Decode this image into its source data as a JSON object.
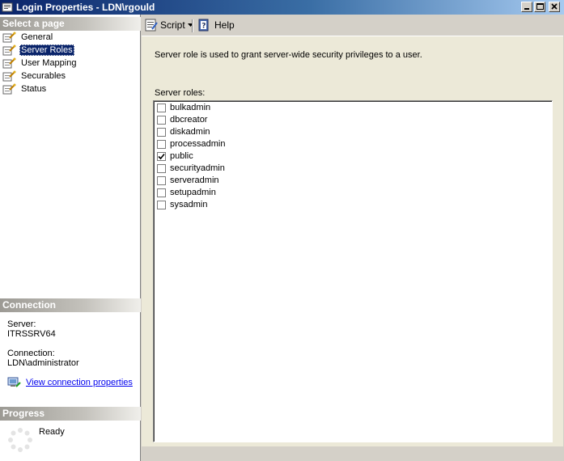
{
  "window": {
    "title": "Login Properties - LDN\\rgould"
  },
  "left_pane": {
    "select_page_header": "Select a page",
    "pages": [
      {
        "label": "General",
        "selected": false
      },
      {
        "label": "Server Roles",
        "selected": true
      },
      {
        "label": "User Mapping",
        "selected": false
      },
      {
        "label": "Securables",
        "selected": false
      },
      {
        "label": "Status",
        "selected": false
      }
    ],
    "connection": {
      "header": "Connection",
      "server_label": "Server:",
      "server_value": "ITRSSRV64",
      "connection_label": "Connection:",
      "connection_value": "LDN\\administrator",
      "view_link": "View connection properties"
    },
    "progress": {
      "header": "Progress",
      "status": "Ready"
    }
  },
  "toolbar": {
    "script_label": "Script",
    "help_label": "Help"
  },
  "main": {
    "description": "Server role is used to grant server-wide security privileges to a user.",
    "roles_label": "Server roles:",
    "roles": [
      {
        "name": "bulkadmin",
        "checked": false
      },
      {
        "name": "dbcreator",
        "checked": false
      },
      {
        "name": "diskadmin",
        "checked": false
      },
      {
        "name": "processadmin",
        "checked": false
      },
      {
        "name": "public",
        "checked": true
      },
      {
        "name": "securityadmin",
        "checked": false
      },
      {
        "name": "serveradmin",
        "checked": false
      },
      {
        "name": "setupadmin",
        "checked": false
      },
      {
        "name": "sysadmin",
        "checked": false
      }
    ]
  },
  "colors": {
    "title_bar": "#0a246a",
    "selection": "#0a246a",
    "link": "#0000ee",
    "panel_bg": "#ece9d8"
  }
}
